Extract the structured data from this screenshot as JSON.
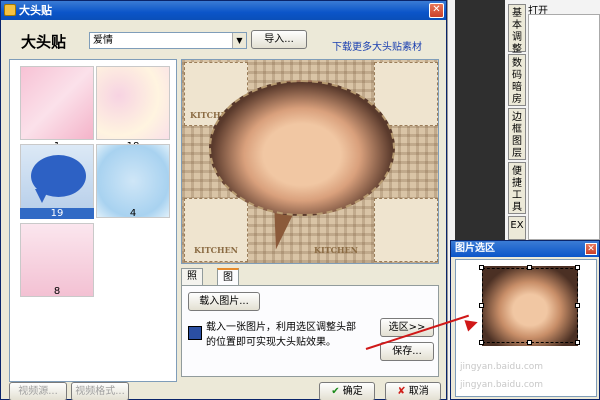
{
  "dialog": {
    "title": "大头贴",
    "close_glyph": "✕",
    "app_label": "大头贴",
    "category_value": "爱情",
    "combo_arrow": "▼",
    "import_label": "导入...",
    "download_link": "下载更多大头贴素材"
  },
  "thumbnails": [
    {
      "caption": "1"
    },
    {
      "caption": "18"
    },
    {
      "caption": "19",
      "selected": true
    },
    {
      "caption": "4"
    },
    {
      "caption": "8"
    }
  ],
  "preview": {
    "kitchen_label": "KITCHEN"
  },
  "tabs": [
    {
      "label": "照相"
    },
    {
      "label": "图片合成",
      "active": true
    }
  ],
  "panel": {
    "load_label": "载入图片...",
    "info_text": "载入一张图片，利用选区调整头部的位置即可实现大头贴效果。",
    "select_label": "选区>>",
    "save_label": "保存..."
  },
  "footer": {
    "video_source": "视频源...",
    "video_format": "视频格式...",
    "ok_label": "确定",
    "cancel_label": "取消",
    "ok_mark": "✔",
    "cancel_mark": "✘"
  },
  "right_panel": {
    "open_label": "打开",
    "vtabs": [
      "基本调整",
      "数码暗房",
      "边框图层",
      "便捷工具",
      "EX"
    ]
  },
  "popup": {
    "title": "图片选区",
    "close_glyph": "✕",
    "watermark": "jingyan.baidu.com"
  },
  "colors": {
    "titlebar": "#0b55c9",
    "selection": "#316ac5",
    "arrow": "#d01818"
  }
}
